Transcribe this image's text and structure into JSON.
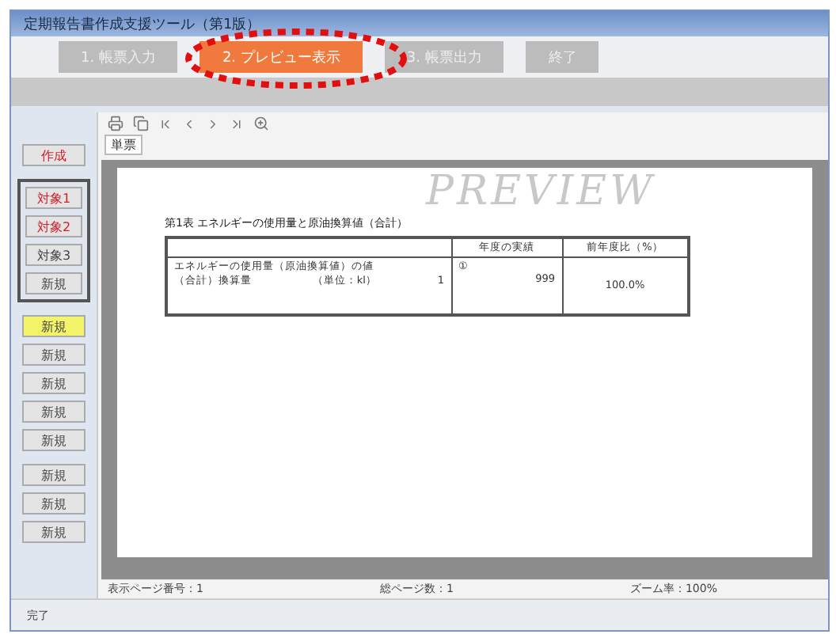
{
  "window": {
    "title": "定期報告書作成支援ツール（第1版）"
  },
  "tabs": [
    {
      "label": "1. 帳票入力",
      "selected": false
    },
    {
      "label": "2. プレビュー表示",
      "selected": true
    },
    {
      "label": "3. 帳票出力",
      "selected": false
    },
    {
      "label": "終了",
      "selected": false
    }
  ],
  "annotation": {
    "kind": "dotted-ellipse"
  },
  "side_groups": [
    {
      "framed": false,
      "buttons": [
        {
          "label": "作成",
          "alert": true,
          "highlighted": false
        }
      ]
    },
    {
      "framed": true,
      "buttons": [
        {
          "label": "対象1",
          "alert": true,
          "highlighted": false
        },
        {
          "label": "対象2",
          "alert": true,
          "highlighted": false
        },
        {
          "label": "対象3",
          "alert": false,
          "highlighted": false
        },
        {
          "label": "新規",
          "alert": false,
          "highlighted": false
        }
      ]
    },
    {
      "framed": false,
      "buttons": [
        {
          "label": "新規",
          "alert": false,
          "highlighted": true
        },
        {
          "label": "新規",
          "alert": false,
          "highlighted": false
        },
        {
          "label": "新規",
          "alert": false,
          "highlighted": false
        },
        {
          "label": "新規",
          "alert": false,
          "highlighted": false
        },
        {
          "label": "新規",
          "alert": false,
          "highlighted": false
        }
      ]
    },
    {
      "framed": false,
      "buttons": [
        {
          "label": "新規",
          "alert": false,
          "highlighted": false
        },
        {
          "label": "新規",
          "alert": false,
          "highlighted": false
        },
        {
          "label": "新規",
          "alert": false,
          "highlighted": false
        }
      ]
    }
  ],
  "preview": {
    "page_tab": "単票",
    "watermark": "PREVIEW",
    "report": {
      "title": "第1表 エネルギーの使用量と原油換算値（合計）",
      "columns": [
        "",
        "年度の実績",
        "前年度比（%）"
      ],
      "row": {
        "label_1": "エネルギーの使用量（原油換算値）の値",
        "label_2": "（合計）換算量",
        "unit": "（単位：kl）",
        "mark": "1",
        "note": "①",
        "value": "999",
        "ratio": "100.0%"
      }
    },
    "status": [
      "表示ページ番号：1",
      "総ページ数：1",
      "ズーム率：100%"
    ]
  },
  "status_bar": "完了"
}
